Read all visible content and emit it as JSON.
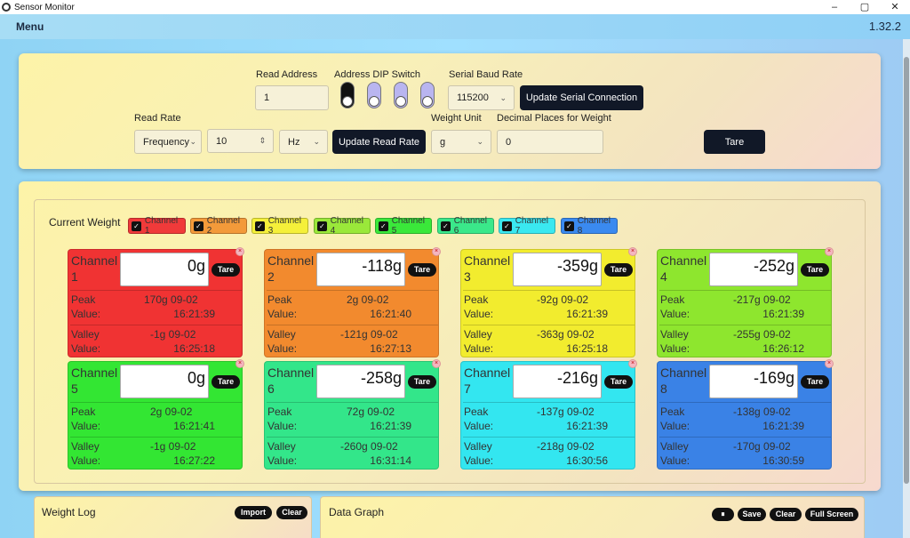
{
  "window": {
    "title": "Sensor Monitor",
    "minimize": "–",
    "maximize": "▢",
    "close": "✕"
  },
  "menubar": {
    "menu": "Menu",
    "version": "1.32.2"
  },
  "settings": {
    "read_address_label": "Read Address",
    "read_address_value": "1",
    "dip_label": "Address DIP Switch",
    "dip_states": [
      true,
      false,
      false,
      false
    ],
    "baud_label": "Serial Baud Rate",
    "baud_value": "115200",
    "update_serial": "Update Serial Connection",
    "read_rate_label": "Read Rate",
    "read_rate_mode": "Frequency",
    "read_rate_value": "10",
    "read_rate_unit": "Hz",
    "update_read_rate": "Update Read Rate",
    "weight_unit_label": "Weight Unit",
    "weight_unit_value": "g",
    "decimals_label": "Decimal Places for Weight",
    "decimals_value": "0",
    "tare": "Tare"
  },
  "current_weight": {
    "title": "Current Weight",
    "toggles": [
      {
        "label": "Channel 1",
        "color": "#f03a3a"
      },
      {
        "label": "Channel 2",
        "color": "#f39a3a"
      },
      {
        "label": "Channel 3",
        "color": "#f5f03a"
      },
      {
        "label": "Channel 4",
        "color": "#9ae83a"
      },
      {
        "label": "Channel 5",
        "color": "#3ae83a"
      },
      {
        "label": "Channel 6",
        "color": "#3ae88a"
      },
      {
        "label": "Channel 7",
        "color": "#3ae8f0"
      },
      {
        "label": "Channel 8",
        "color": "#3a8af0"
      }
    ],
    "peak_label": "Peak",
    "valley_label": "Valley",
    "value_label": "Value:",
    "tare_label": "Tare",
    "close_glyph": "×",
    "channels": [
      {
        "name": "Channel 1",
        "weight": "0g",
        "color": "#f03333",
        "peak": "170g 09-02",
        "peak_time": "16:21:39",
        "valley": "-1g 09-02",
        "valley_time": "16:25:18"
      },
      {
        "name": "Channel 2",
        "weight": "-118g",
        "color": "#f28a2e",
        "peak": "2g 09-02",
        "peak_time": "16:21:40",
        "valley": "-121g 09-02",
        "valley_time": "16:27:13"
      },
      {
        "name": "Channel 3",
        "weight": "-359g",
        "color": "#f2ec2e",
        "peak": "-92g 09-02",
        "peak_time": "16:21:39",
        "valley": "-363g 09-02",
        "valley_time": "16:25:18"
      },
      {
        "name": "Channel 4",
        "weight": "-252g",
        "color": "#8ee62e",
        "peak": "-217g 09-02",
        "peak_time": "16:21:39",
        "valley": "-255g 09-02",
        "valley_time": "16:26:12"
      },
      {
        "name": "Channel 5",
        "weight": "0g",
        "color": "#33e633",
        "peak": "2g 09-02",
        "peak_time": "16:21:41",
        "valley": "-1g 09-02",
        "valley_time": "16:27:22"
      },
      {
        "name": "Channel 6",
        "weight": "-258g",
        "color": "#33e68a",
        "peak": "72g 09-02",
        "peak_time": "16:21:39",
        "valley": "-260g 09-02",
        "valley_time": "16:31:14"
      },
      {
        "name": "Channel 7",
        "weight": "-216g",
        "color": "#33e6f0",
        "peak": "-137g 09-02",
        "peak_time": "16:21:39",
        "valley": "-218g 09-02",
        "valley_time": "16:30:56"
      },
      {
        "name": "Channel 8",
        "weight": "-169g",
        "color": "#3a82e6",
        "peak": "-138g 09-02",
        "peak_time": "16:21:39",
        "valley": "-170g 09-02",
        "valley_time": "16:30:59"
      }
    ]
  },
  "weight_log": {
    "title": "Weight Log",
    "import": "Import",
    "clear": "Clear"
  },
  "data_graph": {
    "title": "Data Graph",
    "pause": "⏸",
    "save": "Save",
    "clear": "Clear",
    "fullscreen": "Full Screen"
  }
}
